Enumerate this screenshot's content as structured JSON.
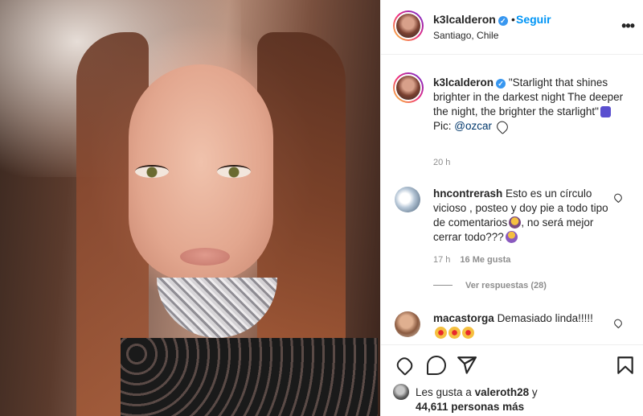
{
  "post": {
    "username": "k3lcalderon",
    "follow_label": "Seguir",
    "separator": "•",
    "location": "Santiago, Chile",
    "more_label": "•••"
  },
  "caption": {
    "username": "k3lcalderon",
    "line1": "\"Starlight that shines brighter in the darkest night",
    "line2": "The deeper the night, the brighter the starlight\"",
    "pic_prefix": "Pic: ",
    "mention": "@ozcar",
    "time": "20 h"
  },
  "comments": [
    {
      "username": "hncontrerash",
      "text_a": "Esto es un círculo vicioso , posteo y doy pie a todo tipo de comentarios",
      "text_b": ", no será mejor cerrar todo???",
      "time": "17 h",
      "likes": "16 Me gusta",
      "replies": "Ver respuestas (28)"
    },
    {
      "username": "macastorga",
      "text": "Demasiado linda!!!!!"
    }
  ],
  "likes": {
    "prefix": "Les gusta a ",
    "user": "valeroth28",
    "and": " y",
    "count": "44,611 personas más"
  },
  "icons": {
    "verified": "verified-badge-icon",
    "heart": "heart-icon",
    "comment": "comment-icon",
    "share": "share-icon",
    "save": "bookmark-icon"
  },
  "colors": {
    "link": "#0095f6",
    "verified": "#3897f0"
  }
}
